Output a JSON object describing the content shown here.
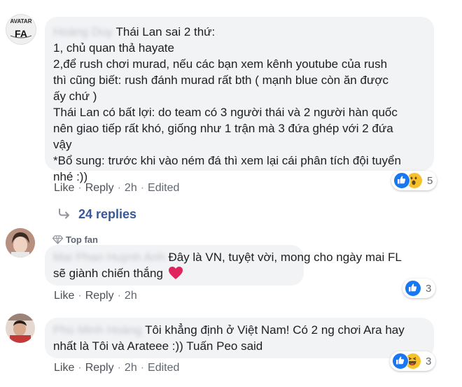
{
  "comments": [
    {
      "avatar_text_top": "AVATAR",
      "avatar_text_bottom": "FA",
      "author": "Hoàng Duy",
      "lines": [
        "Thái Lan sai 2 thứ:",
        "1, chủ quan thả hayate",
        "2,để rush chơi murad, nếu các bạn xem kênh youtube của rush",
        "thì cũng biết: rush đánh murad rất bth ( mạnh blue còn ăn được",
        "ấy chứ )",
        "Thái Lan có bất lợi: do team có 3 người thái và 2 người hàn quốc",
        "nên giao tiếp rất khó, giống như 1 trận mà 3 đứa ghép với 2 đứa",
        "vậy",
        "*Bổ sung: trước khi vào ném đá thì xem lại cái phân tích đội tuyển",
        "nhé :))"
      ],
      "actions": {
        "like": "Like",
        "reply": "Reply",
        "time": "2h",
        "edited": "Edited"
      },
      "reactions": {
        "icons": [
          "like-icon",
          "wow-icon"
        ],
        "count": "5"
      },
      "replies": {
        "icon": "reply-arrow-icon",
        "label": "24 replies"
      }
    },
    {
      "badge": {
        "icon": "diamond-icon",
        "label": "Top fan"
      },
      "author": "Mai Phan Huỳnh Anh",
      "lines": [
        "Đây là VN, tuyệt vời, mong cho ngày mai FL",
        "sẽ giành chiến thắng"
      ],
      "heart_icon": "heart-icon",
      "actions": {
        "like": "Like",
        "reply": "Reply",
        "time": "2h"
      },
      "reactions": {
        "icons": [
          "like-icon"
        ],
        "count": "3"
      }
    },
    {
      "author": "Phú Minh Hoàng",
      "lines": [
        "Tôi khẳng định ở Việt Nam! Có 2 ng chơi Ara hay",
        "nhất là Tôi và Arateee :)) Tuấn Peo said"
      ],
      "actions": {
        "like": "Like",
        "reply": "Reply",
        "time": "2h",
        "edited": "Edited"
      },
      "reactions": {
        "icons": [
          "like-icon",
          "haha-icon"
        ],
        "count": "3"
      }
    }
  ],
  "colors": {
    "bubble": "#f2f3f5",
    "link": "#385898",
    "like_blue": "#1877f2",
    "heart": "#e0245e"
  }
}
